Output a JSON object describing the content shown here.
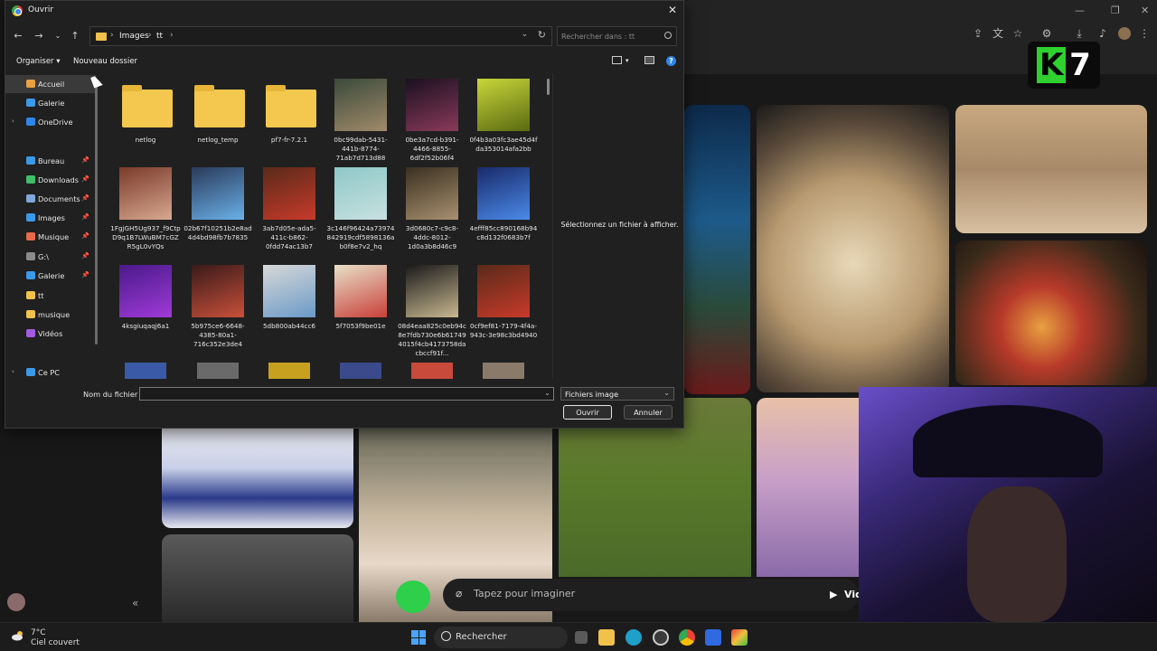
{
  "dialog": {
    "title": "Ouvrir",
    "close_icon": "close-icon",
    "breadcrumb": [
      "Images",
      "tt"
    ],
    "search_placeholder": "Rechercher dans : tt",
    "toolbar": {
      "organize": "Organiser",
      "new_folder": "Nouveau dossier"
    },
    "nav_items": [
      {
        "label": "Accueil",
        "icon": "home-icon",
        "color": "#e8a040",
        "pinned": false,
        "active": true,
        "expander": false
      },
      {
        "label": "Galerie",
        "icon": "gallery-icon",
        "color": "#3b9ae8",
        "pinned": false,
        "active": false,
        "expander": false
      },
      {
        "label": "OneDrive",
        "icon": "cloud-icon",
        "color": "#2f86ea",
        "pinned": false,
        "active": false,
        "expander": true
      },
      {
        "label": "Bureau",
        "icon": "desktop-icon",
        "color": "#3b9ae8",
        "pinned": true,
        "active": false,
        "expander": false
      },
      {
        "label": "Downloads",
        "icon": "download-icon",
        "color": "#3fbf6a",
        "pinned": true,
        "active": false,
        "expander": false
      },
      {
        "label": "Documents",
        "icon": "document-icon",
        "color": "#7fa8d9",
        "pinned": true,
        "active": false,
        "expander": false
      },
      {
        "label": "Images",
        "icon": "images-icon",
        "color": "#3b9ae8",
        "pinned": true,
        "active": false,
        "expander": false
      },
      {
        "label": "Musique",
        "icon": "music-icon",
        "color": "#e86a4a",
        "pinned": true,
        "active": false,
        "expander": false
      },
      {
        "label": "G:\\",
        "icon": "drive-icon",
        "color": "#8a8a8a",
        "pinned": true,
        "active": false,
        "expander": false
      },
      {
        "label": "Galerie",
        "icon": "gallery-icon",
        "color": "#3b9ae8",
        "pinned": true,
        "active": false,
        "expander": false
      },
      {
        "label": "tt",
        "icon": "folder-icon",
        "color": "#f0c24b",
        "pinned": false,
        "active": false,
        "expander": false
      },
      {
        "label": "musique",
        "icon": "folder-icon",
        "color": "#f0c24b",
        "pinned": false,
        "active": false,
        "expander": false
      },
      {
        "label": "Vidéos",
        "icon": "video-icon",
        "color": "#a25be0",
        "pinned": false,
        "active": false,
        "expander": false
      },
      {
        "label": "Ce PC",
        "icon": "pc-icon",
        "color": "#3b9ae8",
        "pinned": false,
        "active": false,
        "expander": true
      }
    ],
    "files": [
      {
        "name": "netlog",
        "kind": "folder"
      },
      {
        "name": "netlog_temp",
        "kind": "folder"
      },
      {
        "name": "pf7-fr-7.2.1",
        "kind": "folder"
      },
      {
        "name": "0bc99dab-5431-441b-8774-71ab7d713d88",
        "kind": "image",
        "colors": [
          "#3b4a3b",
          "#a08a6a"
        ]
      },
      {
        "name": "0be3a7cd-b391-4466-8855-6df2f52b06f4",
        "kind": "image",
        "colors": [
          "#1a1020",
          "#8a3a5a"
        ]
      },
      {
        "name": "0f4b3a03fc3ae45d4fda353014afa2bb",
        "kind": "image",
        "colors": [
          "#c8d63a",
          "#5a6a10"
        ]
      },
      {
        "name": "1FgjGH5Ug937_f9CtpD9q1B7LWuBM7cGZR5gL0vYQs",
        "kind": "image",
        "colors": [
          "#7a3a2a",
          "#d8a890"
        ]
      },
      {
        "name": "02b67f10251b2e8ad4d4bd98fb7b7835",
        "kind": "image",
        "colors": [
          "#2a3a5a",
          "#6ab0e8"
        ]
      },
      {
        "name": "3ab7d05e-ada5-411c-b862-0fdd74ac13b7",
        "kind": "image",
        "colors": [
          "#5a2a1a",
          "#c83a2a"
        ]
      },
      {
        "name": "3c146f96424a73974842919cdf5898136ab0f8e7v2_hq",
        "kind": "image",
        "colors": [
          "#8fc8c8",
          "#c8e0e0"
        ]
      },
      {
        "name": "3d0680c7-c9c8-4ddc-8012-1d0a3b8d46c9",
        "kind": "image",
        "colors": [
          "#3a3020",
          "#a89070"
        ]
      },
      {
        "name": "4efff85cc890168b94c8d132f0683b7f",
        "kind": "image",
        "colors": [
          "#1a2a6a",
          "#4a8ae8"
        ]
      },
      {
        "name": "4ksgiuqaqj6a1",
        "kind": "image",
        "colors": [
          "#4a1a8a",
          "#a03ad8"
        ]
      },
      {
        "name": "5b975ce6-6648-4385-80a1-716c352e3de4",
        "kind": "image",
        "colors": [
          "#3a1a1a",
          "#c8503a"
        ]
      },
      {
        "name": "5db800ab44cc6",
        "kind": "image",
        "colors": [
          "#d8d8d8",
          "#6a9ac8"
        ]
      },
      {
        "name": "5f7053f9be01e",
        "kind": "image",
        "colors": [
          "#e8e0c8",
          "#c8403a"
        ]
      },
      {
        "name": "08d4eaa825c0eb94c8e7fdb730e6b617494015f4cb4173758dacbccf91f...",
        "kind": "image",
        "colors": [
          "#1a1a1a",
          "#c8b890"
        ]
      },
      {
        "name": "0cf9ef81-7179-4f4a-943c-3e98c3bd4940",
        "kind": "image",
        "colors": [
          "#5a2a1a",
          "#c83a2a"
        ]
      }
    ],
    "preview_text": "Sélectionnez un fichier à afficher.",
    "filename_label": "Nom du fichier :",
    "filename_value": "",
    "filetype": "Fichiers image",
    "open_button": "Ouvrir",
    "cancel_button": "Annuler"
  },
  "background": {
    "prompt_placeholder": "Tapez pour imaginer",
    "video_button": "Vid",
    "logo_k": "K",
    "logo_7": "7"
  },
  "taskbar": {
    "weather_temp": "7°C",
    "weather_text": "Ciel couvert",
    "search_label": "Rechercher"
  }
}
